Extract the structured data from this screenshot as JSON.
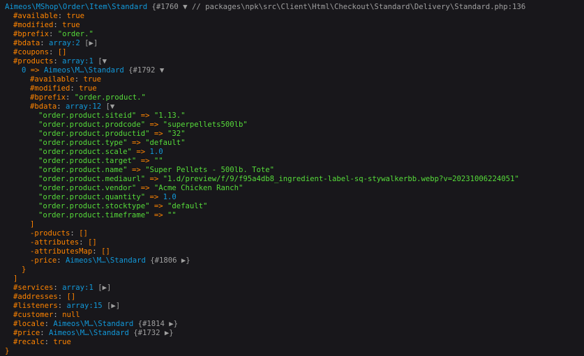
{
  "header": {
    "class": "Aimeos\\MShop\\Order\\Item\\Standard",
    "ref": "{#1760",
    "toggle": "▼",
    "comment": " // packages\\npk\\src\\Client\\Html\\Checkout\\Standard\\Delivery\\Standard.php:136"
  },
  "top": {
    "available_key": "#available",
    "available_val": "true",
    "modified_key": "#modified",
    "modified_val": "true",
    "bprefix_key": "#bprefix",
    "bprefix_val": "\"order.\"",
    "bdata_key": "#bdata",
    "bdata_note": "array:2",
    "bdata_toggle": "[▶]",
    "coupons_key": "#coupons",
    "coupons_val": "[]",
    "products_key": "#products",
    "products_note": "array:1",
    "products_open": "[▼"
  },
  "product0": {
    "index": "0",
    "arrow": "=>",
    "class": "Aimeos\\M…\\Standard",
    "ref": "{#1792",
    "toggle": "▼",
    "available_key": "#available",
    "available_val": "true",
    "modified_key": "#modified",
    "modified_val": "true",
    "bprefix_key": "#bprefix",
    "bprefix_val": "\"order.product.\"",
    "bdata_key": "#bdata",
    "bdata_note": "array:12",
    "bdata_open": "[▼",
    "bdata_items": [
      {
        "k": "\"order.product.siteid\"",
        "v": "\"1.13.\"",
        "t": "str"
      },
      {
        "k": "\"order.product.prodcode\"",
        "v": "\"superpellets500lb\"",
        "t": "str"
      },
      {
        "k": "\"order.product.productid\"",
        "v": "\"32\"",
        "t": "str"
      },
      {
        "k": "\"order.product.type\"",
        "v": "\"default\"",
        "t": "str"
      },
      {
        "k": "\"order.product.scale\"",
        "v": "1.0",
        "t": "num"
      },
      {
        "k": "\"order.product.target\"",
        "v": "\"\"",
        "t": "str"
      },
      {
        "k": "\"order.product.name\"",
        "v": "\"Super Pellets - 500lb. Tote\"",
        "t": "str"
      },
      {
        "k": "\"order.product.mediaurl\"",
        "v": "\"1.d/preview/f/9/f95a4db8_ingredient-label-sq-stywalkerbb.webp?v=20231006224051\"",
        "t": "str"
      },
      {
        "k": "\"order.product.vendor\"",
        "v": "\"Acme Chicken Ranch\"",
        "t": "str"
      },
      {
        "k": "\"order.product.quantity\"",
        "v": "1.0",
        "t": "num"
      },
      {
        "k": "\"order.product.stocktype\"",
        "v": "\"default\"",
        "t": "str"
      },
      {
        "k": "\"order.product.timeframe\"",
        "v": "\"\"",
        "t": "str"
      }
    ],
    "bdata_close": "]",
    "products_key": "-products",
    "products_val": "[]",
    "attributes_key": "-attributes",
    "attributes_val": "[]",
    "attributesMap_key": "-attributesMap",
    "attributesMap_val": "[]",
    "price_key": "-price",
    "price_class": "Aimeos\\M…\\Standard",
    "price_ref": "{#1806",
    "price_toggle": "▶}",
    "close": "}"
  },
  "bottom": {
    "products_close": "]",
    "services_key": "#services",
    "services_note": "array:1",
    "services_toggle": "[▶]",
    "addresses_key": "#addresses",
    "addresses_val": "[]",
    "listeners_key": "#listeners",
    "listeners_note": "array:15",
    "listeners_toggle": "[▶]",
    "customer_key": "#customer",
    "customer_val": "null",
    "locale_key": "#locale",
    "locale_class": "Aimeos\\M…\\Standard",
    "locale_ref": "{#1814",
    "locale_toggle": "▶}",
    "price_key": "#price",
    "price_class": "Aimeos\\M…\\Standard",
    "price_ref": "{#1732",
    "price_toggle": "▶}",
    "recalc_key": "#recalc",
    "recalc_val": "true",
    "close": "}"
  },
  "colors": {
    "background": "#18171b",
    "key": "#ff8400",
    "string": "#56db3a",
    "class": "#1299da",
    "meta": "#a0a0a0"
  }
}
